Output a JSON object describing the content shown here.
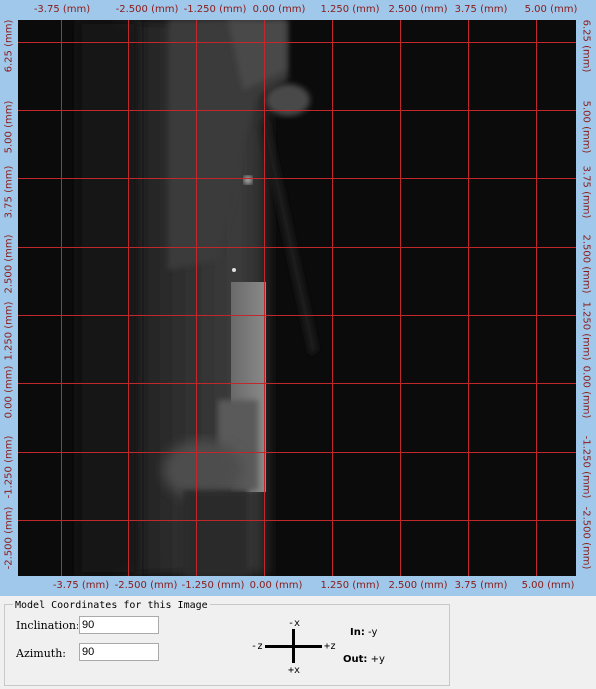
{
  "rulers": {
    "horizontal": [
      "-3.75 (mm)",
      "-2.500 (mm)",
      "-1.250 (mm)",
      "0.00 (mm)",
      "1.250 (mm)",
      "2.500 (mm)",
      "3.75 (mm)",
      "5.00 (mm)"
    ],
    "vertical": [
      "6.25 (mm)",
      "5.00 (mm)",
      "3.75 (mm)",
      "2.500 (mm)",
      "1.250 (mm)",
      "0.00 (mm)",
      "-1.250 (mm)",
      "-2.500 (mm)"
    ],
    "label_color": "#8b1a1a",
    "background": "#9fc8ea"
  },
  "image_view": {
    "grid_color": "#c0282c",
    "background": "#0a0a0a"
  },
  "model_panel": {
    "title": "Model Coordinates for this Image",
    "inclination_label": "Inclination:",
    "inclination_value": "90",
    "azimuth_label": "Azimuth:",
    "azimuth_value": "90",
    "axes": {
      "top": "-x",
      "bottom": "+x",
      "left": "-z",
      "right": "+z"
    },
    "in_label": "In:",
    "in_value": "-y",
    "out_label": "Out:",
    "out_value": "+y"
  }
}
